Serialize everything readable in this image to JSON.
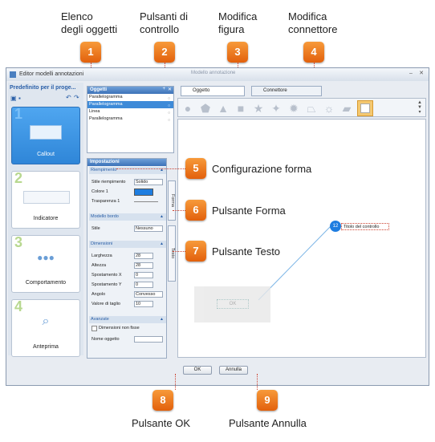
{
  "labels": {
    "elenco": "Elenco\ndegli oggetti",
    "pulsanti": "Pulsanti di\ncontrollo",
    "modifica_figura": "Modifica\nfigura",
    "modifica_connettore": "Modifica\nconnettore",
    "config_forma": "Configurazione forma",
    "pulsante_forma": "Pulsante Forma",
    "pulsante_testo": "Pulsante Testo",
    "pulsante_ok": "Pulsante OK",
    "pulsante_annulla": "Pulsante Annulla"
  },
  "callouts": [
    "1",
    "2",
    "3",
    "4",
    "5",
    "6",
    "7",
    "8",
    "9"
  ],
  "window": {
    "title": "Editor modelli annotazioni",
    "center_title": "Modello annotazione"
  },
  "left_panel": {
    "title": "Predefinito per il proge...",
    "cards": [
      {
        "num": "1",
        "label": "Callout"
      },
      {
        "num": "2",
        "label": "Indicatore"
      },
      {
        "num": "3",
        "label": "Comportamento"
      },
      {
        "num": "4",
        "label": "Anteprima"
      }
    ]
  },
  "objects": {
    "header": "Oggetti",
    "items": [
      "Parallelogramma",
      "Parallelogramma",
      "Linea",
      "Parallelogramma"
    ]
  },
  "settings": {
    "header": "Impostazioni",
    "fill_section": "Riempimento",
    "fill_style_label": "Stile riempimento",
    "fill_style_value": "Solido",
    "color_label": "Colore 1",
    "transparency_label": "Trasparenza 1",
    "border_section": "Modello bordo",
    "border_style_label": "Stile",
    "border_style_value": "Nessuno",
    "dim_section": "Dimensioni",
    "width_label": "Larghezza",
    "width_value": "28",
    "height_label": "Altezza",
    "height_value": "28",
    "shift_x_label": "Spostamento X",
    "shift_x_value": "0",
    "shift_y_label": "Spostamento Y",
    "shift_y_value": "0",
    "angle_label": "Angolo",
    "angle_value": "Convesso",
    "cut_label": "Valore di taglio",
    "cut_value": "10",
    "adv_section": "Avanzate",
    "unfixed_label": "Dimensioni non fisse",
    "name_label": "Nome oggetto",
    "tab_forma": "Forma",
    "tab_testo": "Testo"
  },
  "tabs": {
    "oggetto": "Oggetto",
    "connettore": "Connettore"
  },
  "canvas": {
    "callout_number": "12",
    "callout_text": "Titolo del controllo",
    "ok_placeholder": "OK"
  },
  "buttons": {
    "ok": "OK",
    "cancel": "Annulla"
  },
  "colors": {
    "accent_orange": "#e8701a",
    "selection_blue": "#3d8ad8",
    "fill_color": "#1e7de0"
  }
}
